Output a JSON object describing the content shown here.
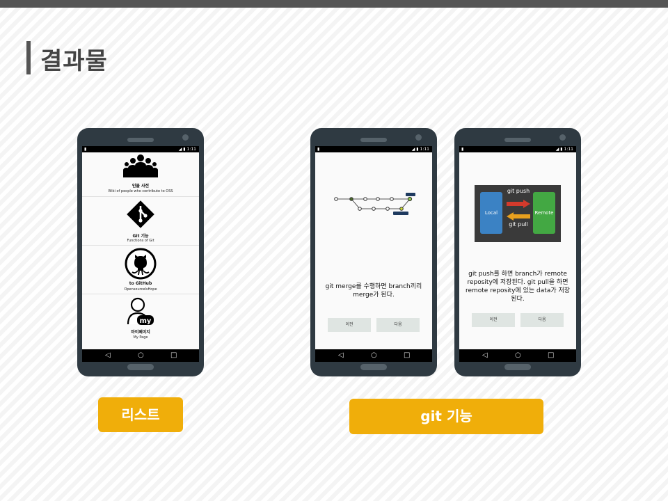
{
  "slide": {
    "title": "결과물"
  },
  "colors": {
    "accent": "#f0ae0a",
    "phone_body": "#2f3a42",
    "dark": "#555555"
  },
  "status_bar": {
    "left_icon": "sd-card-icon",
    "right_text": "1:11"
  },
  "nav": {
    "back": "◁",
    "home": "○",
    "recent": "□"
  },
  "list_screen": {
    "items": [
      {
        "icon": "people-icon",
        "title": "인물 사전",
        "subtitle": "Wiki of people who contribute to OSS"
      },
      {
        "icon": "git-logo-icon",
        "title": "Git 기능",
        "subtitle": "Functions of Git"
      },
      {
        "icon": "octocat-icon",
        "title": "to GitHub",
        "subtitle": "OpensourceIsHope"
      },
      {
        "icon": "my-page-icon",
        "badge": "my",
        "title": "마이페이지",
        "subtitle": "My Page"
      }
    ]
  },
  "git_merge_screen": {
    "description": "git merge를 수행하면 branch끼리 merge가 된다.",
    "prev_label": "이전",
    "next_label": "다음"
  },
  "git_push_screen": {
    "diagram": {
      "local": "Local",
      "remote": "Remote",
      "push": "git push",
      "pull": "git pull"
    },
    "description": "git push를 하면 branch가 remote reposity에 저장된다. git pull을 하면 remote reposity에 있는 data가 저장된다.",
    "prev_label": "이전",
    "next_label": "다음"
  },
  "labels": {
    "list": "리스트",
    "git": "git 기능"
  }
}
